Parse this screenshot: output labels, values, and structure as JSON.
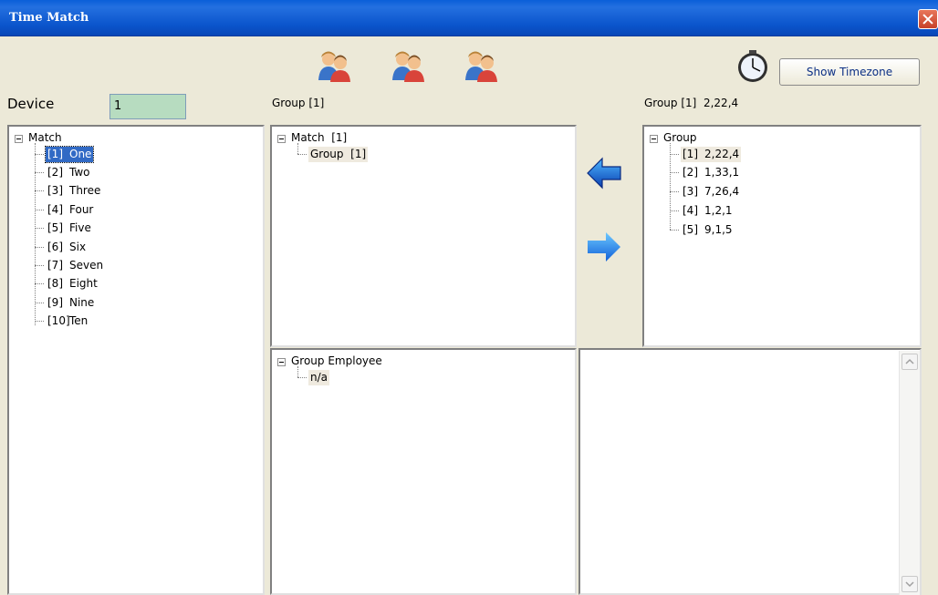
{
  "window": {
    "title": "Time Match"
  },
  "toolbar": {
    "show_timezone_label": "Show Timezone"
  },
  "device": {
    "label": "Device",
    "value": "1"
  },
  "headers": {
    "middle": "Group [1]",
    "right": "Group [1]  2,22,4"
  },
  "match_tree": {
    "root": "Match",
    "items": [
      {
        "num": "[1]",
        "name": "One"
      },
      {
        "num": "[2]",
        "name": "Two"
      },
      {
        "num": "[3]",
        "name": "Three"
      },
      {
        "num": "[4]",
        "name": "Four"
      },
      {
        "num": "[5]",
        "name": "Five"
      },
      {
        "num": "[6]",
        "name": "Six"
      },
      {
        "num": "[7]",
        "name": "Seven"
      },
      {
        "num": "[8]",
        "name": "Eight"
      },
      {
        "num": "[9]",
        "name": "Nine"
      },
      {
        "num": "[10]",
        "name": "Ten"
      }
    ]
  },
  "middle_tree": {
    "root": "Match  [1]",
    "child": "Group  [1]"
  },
  "employee_tree": {
    "root": "Group Employee",
    "child": "n/a"
  },
  "group_tree": {
    "root": "Group",
    "items": [
      {
        "num": "[1]",
        "value": "2,22,4"
      },
      {
        "num": "[2]",
        "value": "1,33,1"
      },
      {
        "num": "[3]",
        "value": "7,26,4"
      },
      {
        "num": "[4]",
        "value": "1,2,1"
      },
      {
        "num": "[5]",
        "value": "9,1,5"
      }
    ]
  }
}
